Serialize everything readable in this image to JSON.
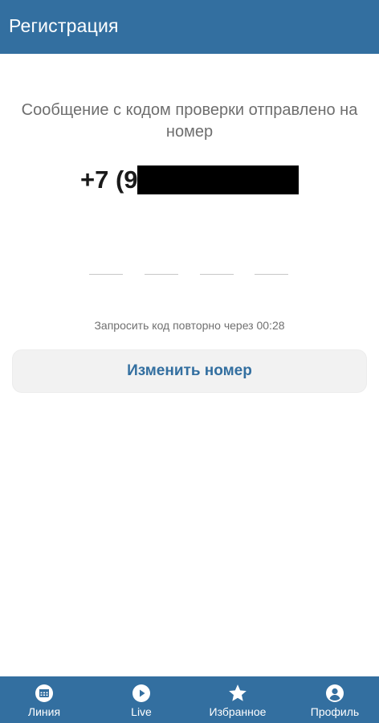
{
  "appbar": {
    "title": "Регистрация"
  },
  "verification": {
    "message": "Сообщение с кодом проверки отправлено на номер",
    "phone_visible": "+7 (9",
    "code_length": 4,
    "resend_text": "Запросить код повторно через 00:28",
    "change_number_label": "Изменить номер"
  },
  "bottom_nav": {
    "items": [
      {
        "label": "Линия",
        "icon": "calendar-icon"
      },
      {
        "label": "Live",
        "icon": "play-icon"
      },
      {
        "label": "Избранное",
        "icon": "star-icon"
      },
      {
        "label": "Профиль",
        "icon": "profile-icon"
      }
    ]
  },
  "colors": {
    "primary": "#336fa0",
    "button_bg": "#f2f2f2",
    "muted_text": "#6e6e6e"
  }
}
